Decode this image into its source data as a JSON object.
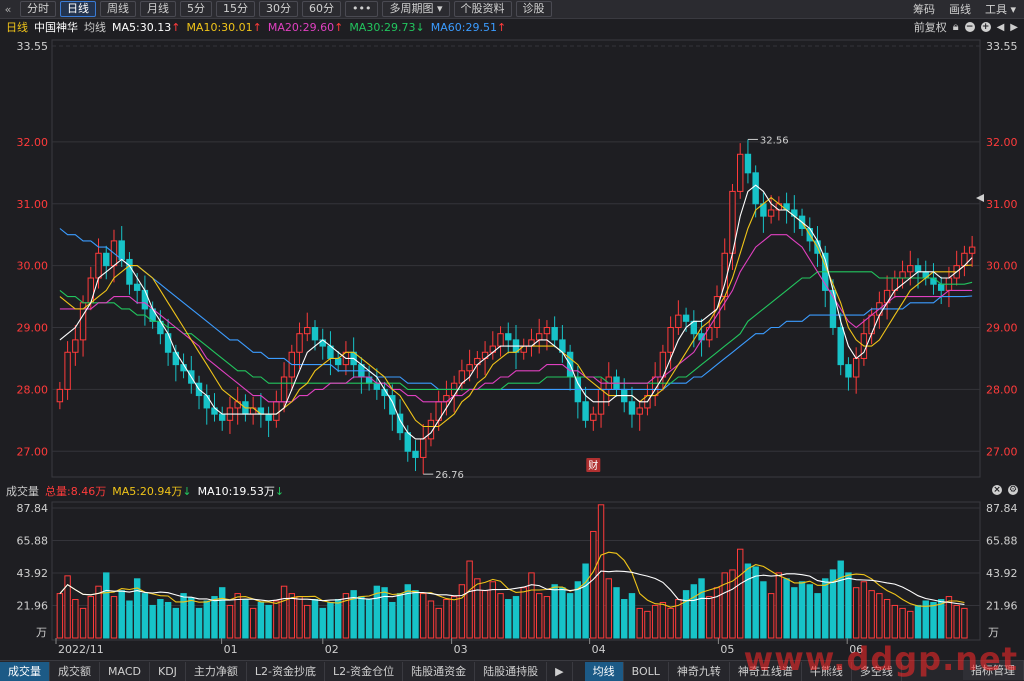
{
  "toolbar": {
    "back_icon": "chevron-double-left-icon",
    "tabs": [
      "分时",
      "日线",
      "周线",
      "月线",
      "5分",
      "15分",
      "30分",
      "60分",
      "•••",
      "多周期图",
      "个股资料",
      "诊股"
    ],
    "active_tab": "日线",
    "right_items": [
      "筹码",
      "画线",
      "工具"
    ]
  },
  "info": {
    "period": "日线",
    "stock_name": "中国神华",
    "ma_type": "均线",
    "ma5": "MA5:30.13",
    "ma10": "MA10:30.01",
    "ma20": "MA20:29.60",
    "ma30": "MA30:29.73",
    "ma60": "MA60:29.51",
    "adjust": "前复权",
    "colors": {
      "ma5": "#ffffff",
      "ma10": "#f0c419",
      "ma20": "#e040c0",
      "ma30": "#22c55e",
      "ma60": "#3b9cff",
      "up": "#ff3b3b",
      "down": "#17c3c8"
    }
  },
  "price_axis": {
    "labels": [
      "33.55",
      "32.00",
      "31.00",
      "30.00",
      "29.00",
      "28.00",
      "27.00"
    ],
    "ticks": [
      33.55,
      32,
      31,
      30,
      29,
      28,
      27
    ],
    "max_label": "32.56",
    "min_label": "26.76",
    "event_badge": "财"
  },
  "volume": {
    "label": "成交量",
    "total": "总量:8.46万",
    "ma5": "MA5:20.94万",
    "ma10": "MA10:19.53万",
    "axis_labels": [
      "87.84",
      "65.88",
      "43.92",
      "21.96"
    ],
    "axis_ticks": [
      87.84,
      65.88,
      43.92,
      21.96
    ],
    "unit": "万"
  },
  "x_axis": {
    "labels": [
      "2022/11",
      "01",
      "02",
      "03",
      "04",
      "05",
      "06"
    ]
  },
  "bottom_tabs": [
    "成交量",
    "成交额",
    "MACD",
    "KDJ",
    "主力净额",
    "L2-资金抄底",
    "L2-资金仓位",
    "陆股通资金",
    "陆股通持股"
  ],
  "indicator_tabs": [
    "均线",
    "BOLL",
    "神奇九转",
    "神奇五线谱",
    "牛熊线",
    "多空线"
  ],
  "right_button": "指标管理",
  "watermark": "www.ddgp.net",
  "chart_data": {
    "type": "candlestick",
    "closes": [
      28.0,
      28.6,
      28.8,
      29.4,
      29.8,
      30.2,
      30.0,
      30.4,
      30.1,
      29.7,
      29.6,
      29.3,
      29.1,
      28.9,
      28.6,
      28.4,
      28.3,
      28.1,
      27.9,
      27.7,
      27.6,
      27.5,
      27.7,
      27.8,
      27.6,
      27.7,
      27.6,
      27.5,
      27.8,
      28.2,
      28.6,
      28.9,
      29.0,
      28.8,
      28.7,
      28.5,
      28.4,
      28.6,
      28.4,
      28.2,
      28.1,
      28.0,
      27.9,
      27.6,
      27.3,
      27.0,
      26.9,
      27.2,
      27.5,
      27.8,
      27.9,
      28.1,
      28.3,
      28.4,
      28.5,
      28.6,
      28.7,
      28.9,
      28.8,
      28.6,
      28.7,
      28.8,
      28.9,
      29.0,
      28.8,
      28.6,
      28.2,
      27.8,
      27.5,
      27.6,
      28.0,
      28.2,
      28.0,
      27.8,
      27.6,
      27.7,
      27.9,
      28.2,
      28.6,
      29.0,
      29.2,
      29.1,
      28.9,
      28.8,
      29.0,
      29.5,
      30.2,
      31.2,
      31.8,
      31.5,
      31.0,
      30.8,
      30.9,
      31.0,
      30.9,
      30.8,
      30.6,
      30.4,
      30.2,
      29.6,
      29.0,
      28.4,
      28.2,
      28.5,
      28.9,
      29.2,
      29.4,
      29.6,
      29.8,
      29.9,
      30.0,
      29.9,
      29.8,
      29.7,
      29.6,
      29.8,
      30.0,
      30.2,
      30.3
    ],
    "volumes": [
      30,
      42,
      26,
      20,
      28,
      35,
      44,
      28,
      32,
      25,
      40,
      30,
      22,
      26,
      24,
      20,
      30,
      27,
      20,
      25,
      28,
      34,
      22,
      30,
      26,
      20,
      24,
      22,
      25,
      35,
      30,
      28,
      22,
      26,
      20,
      24,
      26,
      30,
      32,
      28,
      26,
      35,
      34,
      24,
      30,
      36,
      32,
      30,
      25,
      20,
      26,
      28,
      36,
      52,
      40,
      32,
      38,
      30,
      26,
      28,
      34,
      44,
      30,
      28,
      36,
      34,
      30,
      38,
      50,
      72,
      90,
      40,
      34,
      26,
      30,
      20,
      18,
      22,
      24,
      20,
      26,
      32,
      36,
      40,
      28,
      34,
      44,
      46,
      60,
      50,
      48,
      38,
      30,
      44,
      40,
      34,
      38,
      36,
      30,
      40,
      46,
      52,
      44,
      34,
      38,
      32,
      30,
      26,
      22,
      20,
      18,
      22,
      25,
      24,
      26,
      28,
      22,
      20
    ],
    "ma5": [
      28.8,
      28.9,
      29.0,
      29.2,
      29.4,
      29.8,
      29.9,
      30.0,
      30.1,
      30.0,
      29.8,
      29.6,
      29.3,
      29.1,
      28.9,
      28.6,
      28.4,
      28.2,
      28.0,
      27.9,
      27.7,
      27.6,
      27.6,
      27.6,
      27.6,
      27.6,
      27.6,
      27.6,
      27.6,
      27.7,
      28.0,
      28.3,
      28.6,
      28.7,
      28.8,
      28.7,
      28.6,
      28.5,
      28.5,
      28.4,
      28.3,
      28.2,
      28.0,
      27.8,
      27.5,
      27.3,
      27.2,
      27.2,
      27.3,
      27.5,
      27.7,
      27.9,
      28.1,
      28.2,
      28.4,
      28.5,
      28.6,
      28.7,
      28.7,
      28.7,
      28.7,
      28.7,
      28.8,
      28.8,
      28.7,
      28.6,
      28.4,
      28.1,
      27.9,
      27.8,
      27.8,
      27.8,
      27.9,
      27.9,
      27.9,
      27.8,
      27.8,
      28.0,
      28.2,
      28.5,
      28.8,
      29.0,
      29.1,
      29.1,
      29.2,
      29.3,
      29.7,
      30.2,
      30.8,
      31.2,
      31.3,
      31.2,
      31.0,
      30.9,
      30.9,
      30.8,
      30.7,
      30.6,
      30.4,
      30.1,
      29.6,
      29.1,
      28.7,
      28.5,
      28.6,
      28.9,
      29.2,
      29.4,
      29.6,
      29.7,
      29.8,
      29.9,
      29.9,
      29.9,
      29.8,
      29.8,
      29.9,
      30.0,
      30.13
    ],
    "ma10": [
      29.5,
      29.4,
      29.3,
      29.3,
      29.4,
      29.5,
      29.6,
      29.8,
      29.9,
      30.0,
      30.0,
      29.9,
      29.8,
      29.6,
      29.4,
      29.2,
      29.0,
      28.8,
      28.6,
      28.4,
      28.2,
      28.0,
      27.9,
      27.8,
      27.7,
      27.7,
      27.6,
      27.6,
      27.6,
      27.7,
      27.8,
      28.0,
      28.1,
      28.3,
      28.4,
      28.5,
      28.5,
      28.6,
      28.6,
      28.5,
      28.4,
      28.3,
      28.2,
      28.0,
      27.9,
      27.7,
      27.5,
      27.4,
      27.4,
      27.4,
      27.5,
      27.6,
      27.8,
      27.9,
      28.1,
      28.2,
      28.4,
      28.5,
      28.6,
      28.6,
      28.7,
      28.7,
      28.7,
      28.7,
      28.7,
      28.6,
      28.5,
      28.4,
      28.2,
      28.1,
      28.0,
      27.9,
      27.9,
      27.9,
      27.9,
      27.8,
      27.9,
      27.9,
      28.0,
      28.2,
      28.4,
      28.6,
      28.8,
      29.0,
      29.1,
      29.3,
      29.5,
      29.8,
      30.2,
      30.6,
      30.9,
      31.0,
      31.1,
      31.0,
      30.9,
      30.8,
      30.7,
      30.5,
      30.3,
      30.0,
      29.7,
      29.4,
      29.0,
      28.8,
      28.7,
      28.7,
      28.8,
      29.0,
      29.2,
      29.4,
      29.6,
      29.7,
      29.8,
      29.9,
      29.9,
      29.9,
      29.9,
      30.0,
      30.01
    ],
    "ma20": [
      29.3,
      29.3,
      29.3,
      29.3,
      29.3,
      29.4,
      29.4,
      29.5,
      29.5,
      29.5,
      29.4,
      29.4,
      29.3,
      29.2,
      29.1,
      29.0,
      28.9,
      28.8,
      28.7,
      28.5,
      28.4,
      28.3,
      28.2,
      28.1,
      28.0,
      27.9,
      27.9,
      27.8,
      27.8,
      27.8,
      27.8,
      27.9,
      27.9,
      28.0,
      28.0,
      28.1,
      28.1,
      28.1,
      28.2,
      28.2,
      28.2,
      28.1,
      28.1,
      28.0,
      28.0,
      27.9,
      27.9,
      27.8,
      27.8,
      27.8,
      27.8,
      27.9,
      27.9,
      28.0,
      28.0,
      28.1,
      28.1,
      28.2,
      28.2,
      28.3,
      28.3,
      28.3,
      28.3,
      28.4,
      28.4,
      28.4,
      28.3,
      28.3,
      28.2,
      28.2,
      28.1,
      28.1,
      28.1,
      28.1,
      28.1,
      28.1,
      28.1,
      28.2,
      28.2,
      28.3,
      28.4,
      28.5,
      28.6,
      28.8,
      29.0,
      29.2,
      29.4,
      29.6,
      29.9,
      30.1,
      30.3,
      30.4,
      30.5,
      30.5,
      30.5,
      30.4,
      30.3,
      30.1,
      29.9,
      29.7,
      29.5,
      29.3,
      29.1,
      29.0,
      29.1,
      29.2,
      29.3,
      29.4,
      29.5,
      29.5,
      29.5,
      29.5,
      29.5,
      29.5,
      29.5,
      29.6,
      29.6,
      29.6,
      29.6
    ],
    "ma30": [
      29.6,
      29.5,
      29.5,
      29.4,
      29.4,
      29.4,
      29.4,
      29.4,
      29.3,
      29.3,
      29.2,
      29.2,
      29.1,
      29.1,
      29.0,
      29.0,
      28.9,
      28.9,
      28.8,
      28.7,
      28.6,
      28.5,
      28.4,
      28.3,
      28.3,
      28.2,
      28.2,
      28.1,
      28.1,
      28.1,
      28.1,
      28.1,
      28.1,
      28.1,
      28.1,
      28.1,
      28.1,
      28.1,
      28.1,
      28.1,
      28.1,
      28.1,
      28.1,
      28.1,
      28.1,
      28.0,
      28.0,
      28.0,
      28.0,
      28.0,
      28.0,
      28.0,
      28.0,
      28.0,
      28.0,
      28.0,
      28.0,
      28.0,
      28.1,
      28.1,
      28.1,
      28.1,
      28.1,
      28.2,
      28.2,
      28.2,
      28.2,
      28.2,
      28.2,
      28.2,
      28.2,
      28.1,
      28.1,
      28.1,
      28.1,
      28.1,
      28.1,
      28.1,
      28.1,
      28.1,
      28.2,
      28.2,
      28.3,
      28.4,
      28.5,
      28.6,
      28.7,
      28.8,
      28.9,
      29.1,
      29.2,
      29.3,
      29.4,
      29.5,
      29.6,
      29.7,
      29.8,
      29.8,
      29.9,
      29.9,
      29.9,
      29.9,
      29.9,
      29.9,
      29.9,
      29.9,
      29.8,
      29.8,
      29.8,
      29.8,
      29.8,
      29.8,
      29.8,
      29.8,
      29.7,
      29.7,
      29.7,
      29.7,
      29.73
    ],
    "ma60": [
      30.6,
      30.5,
      30.5,
      30.4,
      30.4,
      30.3,
      30.3,
      30.2,
      30.1,
      30.0,
      30.0,
      29.9,
      29.8,
      29.7,
      29.6,
      29.5,
      29.4,
      29.3,
      29.2,
      29.1,
      29.0,
      28.9,
      28.8,
      28.8,
      28.7,
      28.6,
      28.6,
      28.5,
      28.5,
      28.5,
      28.4,
      28.4,
      28.4,
      28.4,
      28.4,
      28.4,
      28.3,
      28.3,
      28.3,
      28.3,
      28.3,
      28.2,
      28.2,
      28.2,
      28.2,
      28.1,
      28.1,
      28.1,
      28.1,
      28.0,
      28.0,
      28.0,
      28.0,
      28.0,
      28.0,
      28.0,
      28.0,
      28.0,
      28.0,
      28.0,
      28.0,
      28.0,
      28.0,
      28.0,
      28.0,
      28.0,
      28.0,
      28.0,
      28.0,
      28.0,
      28.0,
      28.0,
      28.0,
      28.0,
      28.0,
      28.0,
      28.0,
      28.0,
      28.0,
      28.1,
      28.1,
      28.1,
      28.2,
      28.2,
      28.3,
      28.4,
      28.5,
      28.6,
      28.7,
      28.8,
      28.9,
      28.9,
      29.0,
      29.0,
      29.1,
      29.1,
      29.1,
      29.2,
      29.2,
      29.2,
      29.2,
      29.2,
      29.2,
      29.2,
      29.2,
      29.3,
      29.3,
      29.3,
      29.3,
      29.3,
      29.4,
      29.4,
      29.4,
      29.4,
      29.5,
      29.5,
      29.5,
      29.5,
      29.51
    ],
    "ylim": [
      26.6,
      33.55
    ],
    "vol_max": 87.84
  }
}
